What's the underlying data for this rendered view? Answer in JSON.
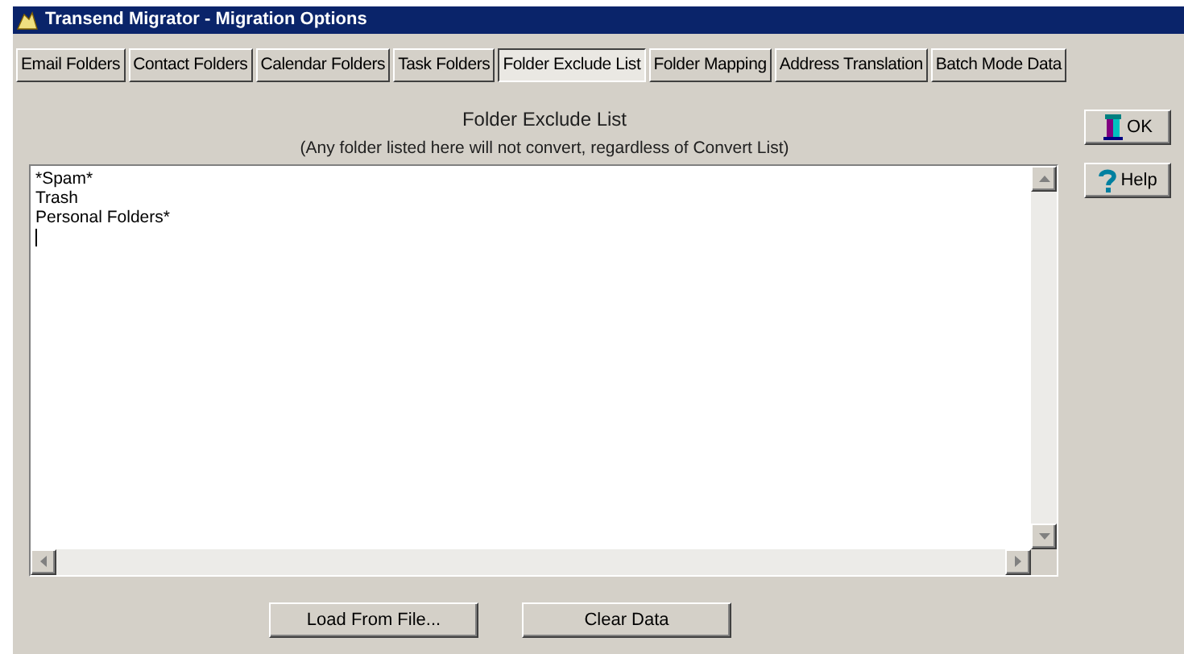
{
  "window": {
    "title": "Transend Migrator - Migration Options"
  },
  "tabs": [
    {
      "label": "Email Folders",
      "selected": false
    },
    {
      "label": "Contact Folders",
      "selected": false
    },
    {
      "label": "Calendar Folders",
      "selected": false
    },
    {
      "label": "Task Folders",
      "selected": false
    },
    {
      "label": "Folder Exclude List",
      "selected": true
    },
    {
      "label": "Folder Mapping",
      "selected": false
    },
    {
      "label": "Address Translation",
      "selected": false
    },
    {
      "label": "Batch Mode Data",
      "selected": false
    }
  ],
  "heading": "Folder Exclude List",
  "subheading": "(Any folder listed here will not convert, regardless of Convert List)",
  "exclude_list": {
    "lines": [
      "*Spam*",
      "Trash",
      "Personal Folders*"
    ]
  },
  "side_buttons": [
    {
      "kind": "ok",
      "label": "OK"
    },
    {
      "kind": "help",
      "label": "Help"
    }
  ],
  "bottom_buttons": [
    "Load From File...",
    "Clear Data"
  ]
}
